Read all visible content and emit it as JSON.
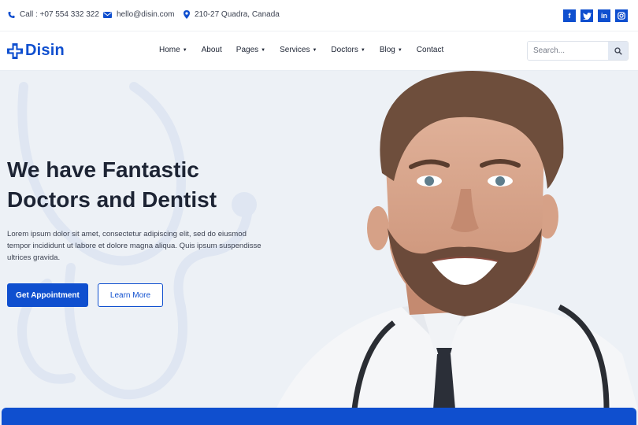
{
  "topbar": {
    "phone": "Call : +07 554 332 322",
    "email": "hello@disin.com",
    "address": "210-27 Quadra, Canada",
    "socials": [
      {
        "icon": "facebook-icon",
        "glyph": "f"
      },
      {
        "icon": "twitter-icon",
        "glyph": "t"
      },
      {
        "icon": "linkedin-icon",
        "glyph": "in"
      },
      {
        "icon": "instagram-icon",
        "glyph": "◎"
      }
    ]
  },
  "header": {
    "logo_text": "Disin",
    "nav": [
      {
        "label": "Home",
        "has_dropdown": true
      },
      {
        "label": "About",
        "has_dropdown": false
      },
      {
        "label": "Pages",
        "has_dropdown": true
      },
      {
        "label": "Services",
        "has_dropdown": true
      },
      {
        "label": "Doctors",
        "has_dropdown": true
      },
      {
        "label": "Blog",
        "has_dropdown": true
      },
      {
        "label": "Contact",
        "has_dropdown": false
      }
    ],
    "search_placeholder": "Search..."
  },
  "hero": {
    "title_line1": "We have Fantastic",
    "title_line2": "Doctors and Dentist",
    "text_line1": "Lorem ipsum dolor sit amet, consectetur adipiscing elit, sed do eiusmod",
    "text_line2": "tempor incididunt ut labore et dolore magna aliqua. Quis ipsum suspendisse",
    "text_line3": "ultrices gravida.",
    "primary_button": "Get Appointment",
    "secondary_button": "Learn More"
  },
  "colors": {
    "brand": "#0f4fcf",
    "text_dark": "#1d2434",
    "hero_bg": "#edf1f6"
  }
}
